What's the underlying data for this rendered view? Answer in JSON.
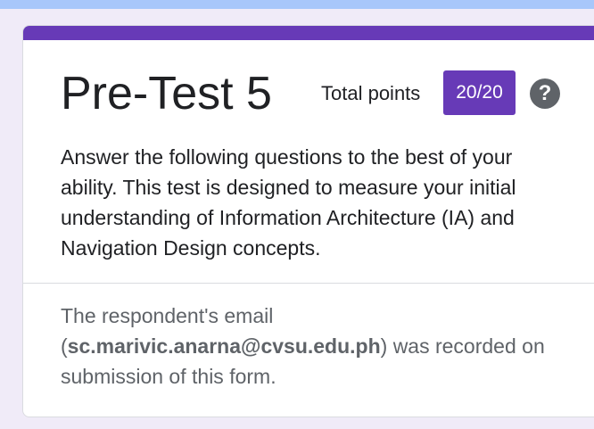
{
  "colors": {
    "accent": "#673ab7",
    "top_strip": "#a8c7fa",
    "background": "#f0ebf8",
    "text_primary": "#202124",
    "text_secondary": "#5f6368"
  },
  "form": {
    "title": "Pre-Test 5",
    "total_points_label": "Total points",
    "score": "20/20",
    "help_icon": "help-circle-icon",
    "help_glyph": "?",
    "description": " Answer the following questions to the best of your ability. This test is designed to measure your initial understanding of Information Architecture (IA) and Navigation Design concepts.",
    "email_note": {
      "prefix": "The respondent's email (",
      "email": "sc.marivic.anarna@cvsu.edu.ph",
      "suffix": ") was recorded on submission of this form."
    }
  }
}
